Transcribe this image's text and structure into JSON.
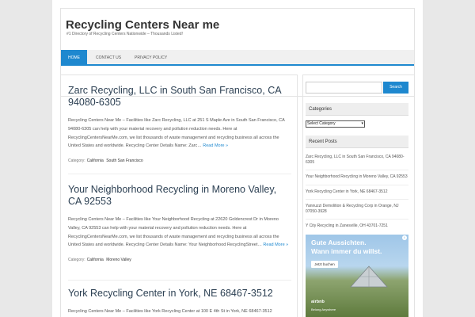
{
  "site": {
    "title": "Recycling Centers Near me",
    "description": "#1 Directory of Recycling Centers Nationwide – Thousands Listed!"
  },
  "nav": {
    "items": [
      {
        "label": "Home"
      },
      {
        "label": "Contact Us"
      },
      {
        "label": "Privacy Policy"
      }
    ]
  },
  "posts": [
    {
      "title": "Zarc Recycling, LLC in South San Francisco, CA 94080-6305",
      "excerpt": "Recycling Centers Near Me – Facilities like Zarc Recycling, LLC at 251 S Maple Ave in South San Francisco, CA 94080-6305 can help with your material recovery and pollution reduction needs. Here at RecyclingCentersNearMe.com, we list thousands of waste management and recycling business all across the United States and worldwide. Recycling Center Details Name: Zarc…",
      "read_more": "Read More »",
      "category_label": "Category:",
      "categories": [
        "California",
        "South San Francisco"
      ]
    },
    {
      "title": "Your Neighborhood Recycling in Moreno Valley, CA 92553",
      "excerpt": "Recycling Centers Near Me – Facilities like Your Neighborhood Recycling at 22620 Goldencrest Dr in Moreno Valley, CA 92553 can help with your material recovery and pollution reduction needs. Here at RecyclingCentersNearMe.com, we list thousands of waste management and recycling business all across the United States and worldwide. Recycling Center Details Name: Your Neighborhood RecyclingStreet…",
      "read_more": "Read More »",
      "category_label": "Category:",
      "categories": [
        "California",
        "Moreno Valley"
      ]
    },
    {
      "title": "York Recycling Center in York, NE 68467-3512",
      "excerpt": "Recycling Centers Near Me – Facilities like York Recycling Center at 100 E 4th St in York, NE 68467-3512"
    }
  ],
  "sidebar": {
    "search": {
      "placeholder": "",
      "button_label": "Search"
    },
    "categories_title": "Categories",
    "category_select": "Select Category",
    "recent_title": "Recent Posts",
    "recent_posts": [
      "Zarc Recycling, LLC in South San Francisco, CA 94080-6305",
      "Your Neighborhood Recycling in Moreno Valley, CA 92553",
      "York Recycling Center in York, NE 68467-3512",
      "Yannuzzi Demolition & Recycling Corp in Orange, NJ 07050-3928",
      "Y City Recycling in Zanesville, OH 43701-7251"
    ],
    "ad": {
      "line1": "Gute Aussichten.",
      "line2": "Wann immer du willst.",
      "button": "Jetzt buchen",
      "brand": "airbnb",
      "sub": "Belong Anywhere"
    }
  },
  "colors": {
    "accent": "#1e88cf",
    "title": "#2b3f52"
  }
}
